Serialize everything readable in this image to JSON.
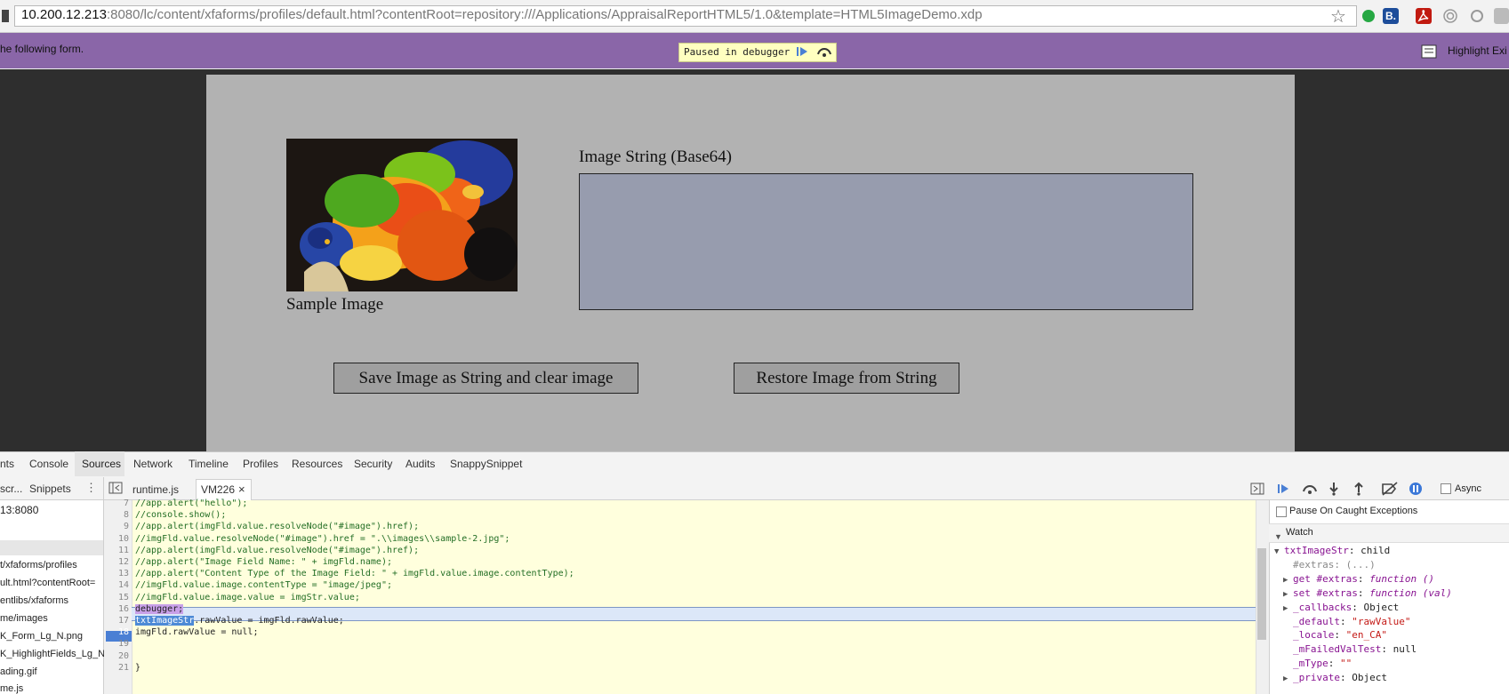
{
  "browser": {
    "url_host": "10.200.12.213",
    "url_rest": ":8080/lc/content/xfaforms/profiles/default.html?contentRoot=repository:///Applications/AppraisalReportHTML5/1.0&template=HTML5ImageDemo.xdp",
    "ext_b_label": "B."
  },
  "banner": {
    "text": "he following form.",
    "paused": "Paused in debugger",
    "highlight": "Highlight Exi"
  },
  "form": {
    "image_caption": "Sample Image",
    "image_string_label": "Image String (Base64)",
    "image_string_value": "",
    "save_button": "Save Image as String and clear image",
    "restore_button": "Restore Image from String"
  },
  "devtools": {
    "tabs": [
      "nts",
      "Console",
      "Sources",
      "Network",
      "Timeline",
      "Profiles",
      "Resources",
      "Security",
      "Audits",
      "SnappySnippet"
    ],
    "nav_tabs": [
      "scr...",
      "Snippets"
    ],
    "nav_items": [
      "13:8080",
      "t/xfaforms/profiles",
      "ult.html?contentRoot=",
      "entlibs/xfaforms",
      "me/images",
      "K_Form_Lg_N.png",
      "K_HighlightFields_Lg_N",
      "ading.gif",
      "me.js"
    ],
    "file_tabs": [
      "runtime.js",
      "VM226"
    ],
    "close_glyph": "×",
    "code": [
      {
        "n": "7",
        "t": "//app.alert(\"hello\");",
        "k": "cmt"
      },
      {
        "n": "8",
        "t": "//console.show();",
        "k": "cmt"
      },
      {
        "n": "9",
        "t": "//app.alert(imgFld.value.resolveNode(\"#image\").href);",
        "k": "cmt"
      },
      {
        "n": "10",
        "t": "//imgFld.value.resolveNode(\"#image\").href = \".\\\\images\\\\sample-2.jpg\";",
        "k": "cmt"
      },
      {
        "n": "11",
        "t": "//app.alert(imgFld.value.resolveNode(\"#image\").href);",
        "k": "cmt"
      },
      {
        "n": "12",
        "t": "//app.alert(\"Image Field Name: \" + imgFld.name);",
        "k": "cmt"
      },
      {
        "n": "13",
        "t": "//app.alert(\"Content Type of the Image Field: \" + imgFld.value.image.contentType);",
        "k": "cmt"
      },
      {
        "n": "14",
        "t": "//imgFld.value.image.contentType = \"image/jpeg\";",
        "k": "cmt"
      },
      {
        "n": "15",
        "t": "//imgFld.value.image.value = imgStr.value;",
        "k": "cmt"
      },
      {
        "n": "16",
        "t": "debugger;",
        "k": "dbg"
      },
      {
        "n": "17",
        "t": ".rawValue = imgFld.rawValue;",
        "k": "sel",
        "sel": "txtImageStr"
      },
      {
        "n": "18",
        "t": "imgFld.rawValue = null;",
        "k": "plain"
      },
      {
        "n": "19",
        "t": "",
        "k": "plain"
      },
      {
        "n": "20",
        "t": "",
        "k": "plain"
      },
      {
        "n": "21",
        "t": "}",
        "k": "plain"
      }
    ],
    "right": {
      "async": "Async",
      "pause_caught": "Pause On Caught Exceptions",
      "watch": "Watch",
      "watch_rows": [
        {
          "tri": "▼",
          "k": "txtImageStr",
          "v": ": child"
        },
        {
          "tri": "",
          "k": "#extras",
          "v": ": (...)",
          "dim": true
        },
        {
          "tri": "▶",
          "k": "get #extras",
          "v": ": ",
          "f": "function ()"
        },
        {
          "tri": "▶",
          "k": "set #extras",
          "v": ": ",
          "f": "function (val)"
        },
        {
          "tri": "▶",
          "k": "_callbacks",
          "v": ": Object"
        },
        {
          "tri": "",
          "k": "_default",
          "v": ": ",
          "s": "\"rawValue\""
        },
        {
          "tri": "",
          "k": "_locale",
          "v": ": ",
          "s": "\"en_CA\""
        },
        {
          "tri": "",
          "k": "_mFailedValTest",
          "v": ": null"
        },
        {
          "tri": "",
          "k": "_mType",
          "v": ": ",
          "s": "\"\""
        },
        {
          "tri": "▶",
          "k": "_private",
          "v": ": Object"
        }
      ]
    }
  }
}
